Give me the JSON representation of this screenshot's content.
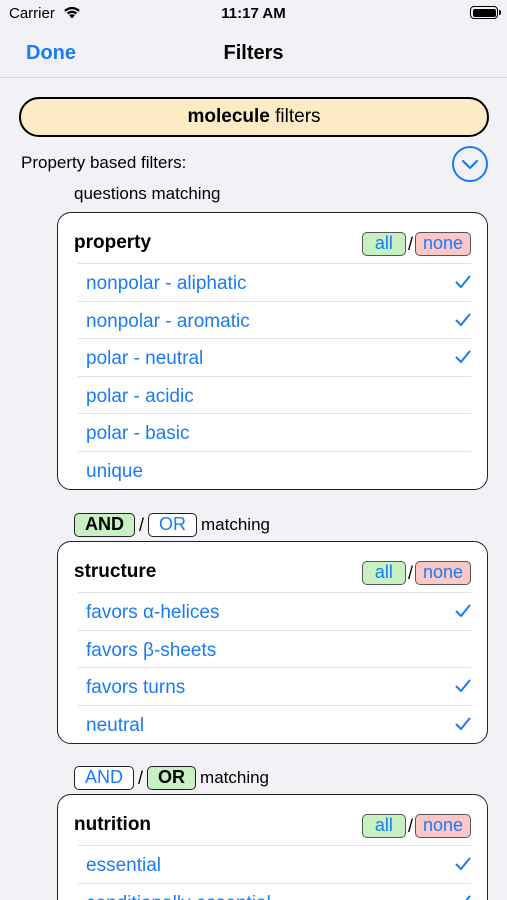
{
  "status": {
    "carrier": "Carrier",
    "time": "11:17 AM"
  },
  "nav": {
    "done": "Done",
    "title": "Filters"
  },
  "section": {
    "bold": "molecule",
    "rest": " filters"
  },
  "property_based_label": "Property based filters:",
  "questions_matching": "questions matching",
  "colors": {
    "accent": "#1a7bf5",
    "pill": "#fcebc4",
    "all_bg": "#c8f0c2",
    "none_bg": "#fbc7c7"
  },
  "groups": [
    {
      "title": "property",
      "all": "all",
      "none": "none",
      "items": [
        {
          "label": "nonpolar - aliphatic",
          "checked": true
        },
        {
          "label": "nonpolar - aromatic",
          "checked": true
        },
        {
          "label": "polar - neutral",
          "checked": true
        },
        {
          "label": "polar - acidic",
          "checked": false
        },
        {
          "label": "polar - basic",
          "checked": false
        },
        {
          "label": "unique",
          "checked": false
        }
      ]
    },
    {
      "connector": {
        "and": "AND",
        "or": "OR",
        "selected": "AND",
        "matching": "matching"
      },
      "title": "structure",
      "all": "all",
      "none": "none",
      "items": [
        {
          "label": "favors α-helices",
          "checked": true
        },
        {
          "label": "favors β-sheets",
          "checked": false
        },
        {
          "label": "favors turns",
          "checked": true
        },
        {
          "label": "neutral",
          "checked": true
        }
      ]
    },
    {
      "connector": {
        "and": "AND",
        "or": "OR",
        "selected": "OR",
        "matching": "matching"
      },
      "title": "nutrition",
      "all": "all",
      "none": "none",
      "items": [
        {
          "label": "essential",
          "checked": true
        },
        {
          "label": "conditionally essential",
          "checked": true
        }
      ]
    }
  ]
}
